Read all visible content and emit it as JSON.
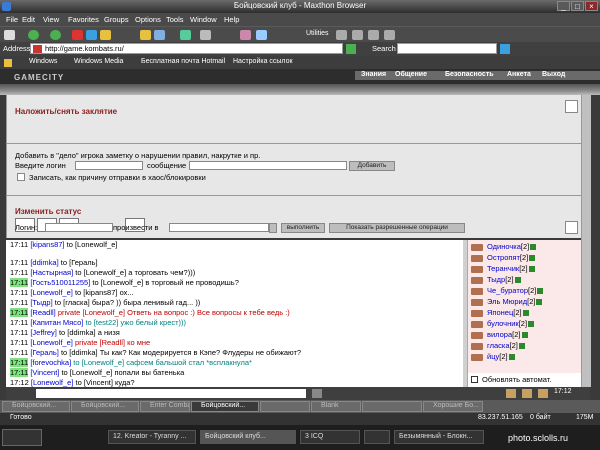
{
  "window": {
    "title": "Бойцовский клуб - Maxthon Browser"
  },
  "menu": [
    "File",
    "Edit",
    "View",
    "Favorites",
    "Groups",
    "Options",
    "Tools",
    "Window",
    "Help"
  ],
  "toolbar": {
    "utilities": "Utilities"
  },
  "address": {
    "label": "Address",
    "url": "http://game.kombats.ru/",
    "search_label": "Search"
  },
  "links": [
    "Windows",
    "Windows Media",
    "Бесплатная почта Hotmail",
    "Настройка ссылок"
  ],
  "site": {
    "logo": "GAMECITY",
    "nav": [
      "Знания",
      "Общение",
      "Безопасность",
      "Анкета",
      "Выход"
    ]
  },
  "spell": {
    "title": "Наложить/снять заклятие",
    "note_line": "Добавить в \"дело\" игрока заметку о нарушении правил, накрутке и пр.",
    "login_label": "Введите логин",
    "message_label": "сообщение",
    "add_button": "Добавить",
    "checkbox_label": "Записать, как причину отправки в хаос/блокировки"
  },
  "status": {
    "title": "Изменить статус",
    "login_label": "Логин:",
    "produce_label": "произвести в",
    "do_button": "выполнить",
    "show_button": "Показать разрешенные операции"
  },
  "chat": [
    {
      "ts": "17:11",
      "hl": false,
      "nick": "[kipans87]",
      "nick_class": "",
      "to": "to [Lonewolf_e]",
      "msg": "",
      "msg_class": ""
    },
    {
      "ts": "17:11",
      "hl": false,
      "nick": "[ddimka]",
      "nick_class": "",
      "to": "to [Гераль]",
      "msg": "",
      "msg_class": ""
    },
    {
      "ts": "17:11",
      "hl": false,
      "nick": "[Настырная]",
      "nick_class": "",
      "to": "to [Lonewolf_e]",
      "msg": "а торговать чем?)))",
      "msg_class": ""
    },
    {
      "ts": "17:11",
      "hl": true,
      "nick": "[Гость510011255]",
      "nick_class": "",
      "to": "to [Lonewolf_e]",
      "msg": "в торговый не проводишь?",
      "msg_class": ""
    },
    {
      "ts": "17:11",
      "hl": false,
      "nick": "[Lonewolf_e]",
      "nick_class": "",
      "to": "to [kipans87]",
      "msg": "ох...",
      "msg_class": ""
    },
    {
      "ts": "17:11",
      "hl": false,
      "nick": "[Тыдр]",
      "nick_class": "",
      "to": "to [гласка]",
      "msg": "быра? )) быра ленивый гад... ))",
      "msg_class": ""
    },
    {
      "ts": "17:11",
      "hl": true,
      "nick": "[Readll]",
      "nick_class": "",
      "to": "private [Lonewolf_e]",
      "msg": "Ответь на вопрос :) Все вопросы к тебе ведь :)",
      "msg_class": "red"
    },
    {
      "ts": "17:11",
      "hl": false,
      "nick": "[Капитан Мясо]",
      "nick_class": "",
      "to": "to [test22]",
      "msg": "ужо белый крест)))",
      "msg_class": "teal"
    },
    {
      "ts": "17:11",
      "hl": false,
      "nick": "[Jeffrey]",
      "nick_class": "",
      "to": "to [ddimka]",
      "msg": "а низя",
      "msg_class": ""
    },
    {
      "ts": "17:11",
      "hl": false,
      "nick": "[Lonewolf_e]",
      "nick_class": "",
      "to": "private [Readll]",
      "msg": "ко мне",
      "msg_class": "red"
    },
    {
      "ts": "17:11",
      "hl": false,
      "nick": "[Гераль]",
      "nick_class": "",
      "to": "to [ddimka]",
      "msg": "Ты как? Как модерируется в Кэпе? Флудеры не обижают?",
      "msg_class": ""
    },
    {
      "ts": "17:11",
      "hl": true,
      "nick": "[forevochka]",
      "nick_class": "",
      "to": "to [Lonewolf_e]",
      "msg": "сафсем бальшой стал *всплакнула*",
      "msg_class": "teal"
    },
    {
      "ts": "17:11",
      "hl": true,
      "nick": "[Vincent]",
      "nick_class": "",
      "to": "to [Lonewolf_e]",
      "msg": "попали вы батенька",
      "msg_class": ""
    },
    {
      "ts": "17:12",
      "hl": false,
      "nick": "[Lonewolf_e]",
      "nick_class": "",
      "to": "to [Vincent]",
      "msg": "куда?",
      "msg_class": ""
    }
  ],
  "users": [
    {
      "name": "Одиночка",
      "level": "[2]"
    },
    {
      "name": "Остропят",
      "level": "[2]"
    },
    {
      "name": "Теранчик",
      "level": "[2]"
    },
    {
      "name": "Тыдр",
      "level": "[2]"
    },
    {
      "name": "Че_буратор",
      "level": "[2]"
    },
    {
      "name": "Эль Мюрид",
      "level": "[2]"
    },
    {
      "name": "Японец",
      "level": "[2]"
    },
    {
      "name": "булочник",
      "level": "[2]"
    },
    {
      "name": "вилора",
      "level": "[2]"
    },
    {
      "name": "гласка",
      "level": "[2]"
    },
    {
      "name": "йцу",
      "level": "[2]"
    }
  ],
  "auto_update": "Обновлять автомат.",
  "clock": "17:12",
  "tabs": [
    "Бойцовский...",
    "Бойцовский...",
    "Enter Combats.ru",
    "Бойцовский...",
    "",
    "Blank",
    "",
    "Хорошие Бо..."
  ],
  "statusbar": {
    "left": "Готово",
    "ip": "83.237.51.165",
    "bytes": "0 байт",
    "mem": "175М"
  },
  "taskbar": [
    "12. Kreator - Tyranny ...",
    "Бойцовский клуб...",
    "3 ICQ",
    "",
    "Безымянный - Блокн..."
  ],
  "watermark": "photo.sclolls.ru"
}
